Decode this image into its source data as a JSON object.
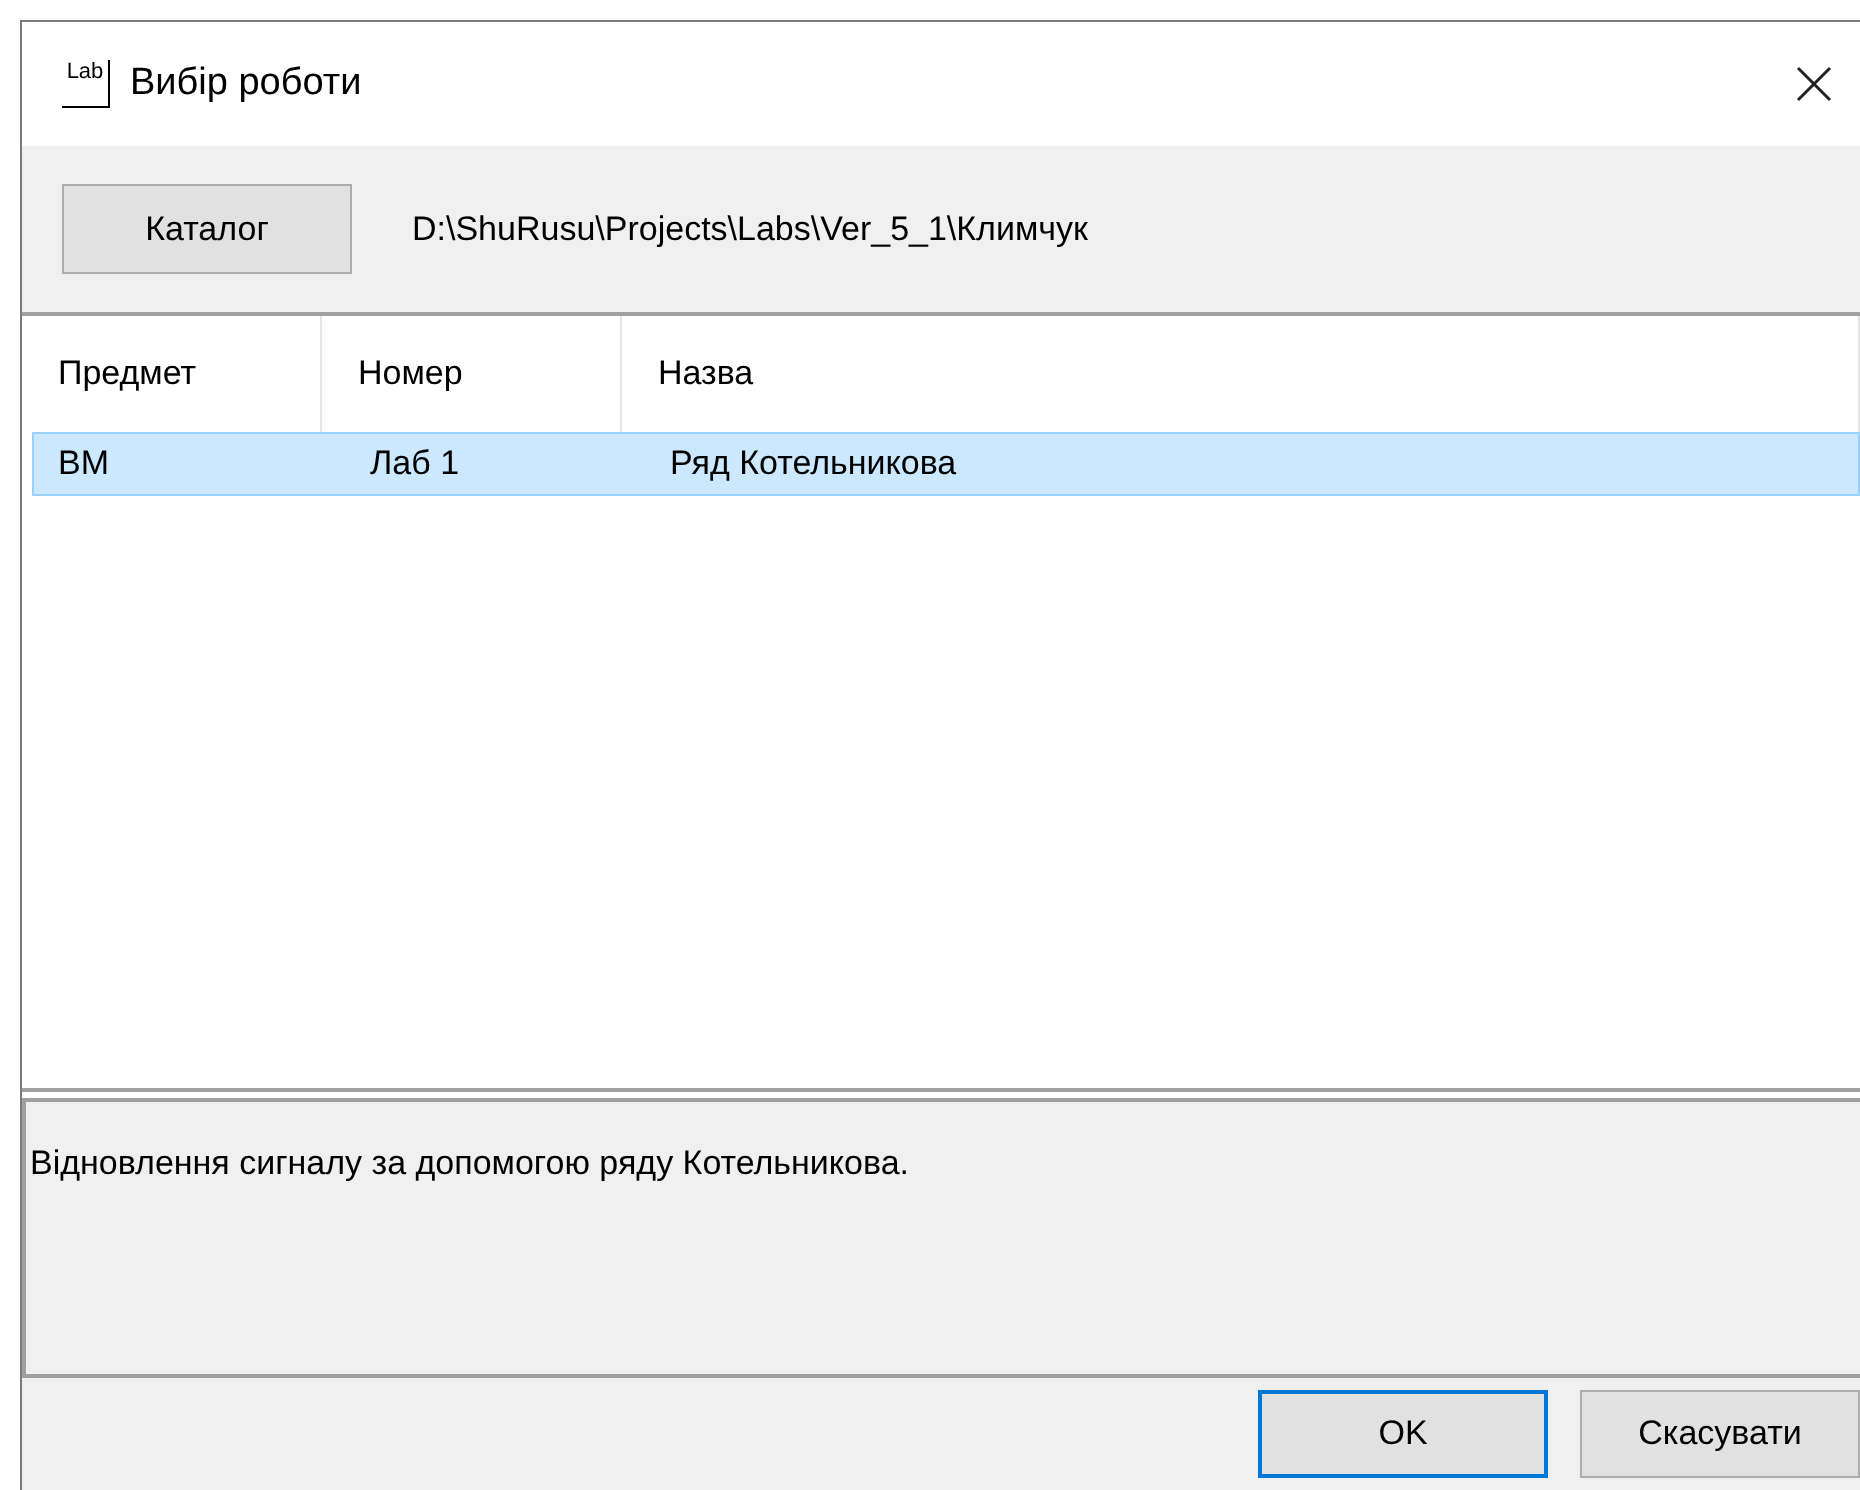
{
  "window": {
    "title": "Вибір роботи",
    "icon_text": "Lab"
  },
  "toolbar": {
    "catalog_button": "Каталог",
    "path": "D:\\ShuRusu\\Projects\\Labs\\Ver_5_1\\Климчук"
  },
  "table": {
    "columns": [
      "Предмет",
      "Номер",
      "Назва"
    ],
    "rows": [
      {
        "cells": [
          "ВМ",
          "Лаб 1",
          "Ряд Котельникова"
        ],
        "selected": true
      }
    ]
  },
  "description": "Відновлення сигналу за допомогою ряду Котельникова.",
  "buttons": [
    {
      "label": "OK",
      "default": true
    },
    {
      "label": "Скасувати",
      "default": false
    }
  ]
}
